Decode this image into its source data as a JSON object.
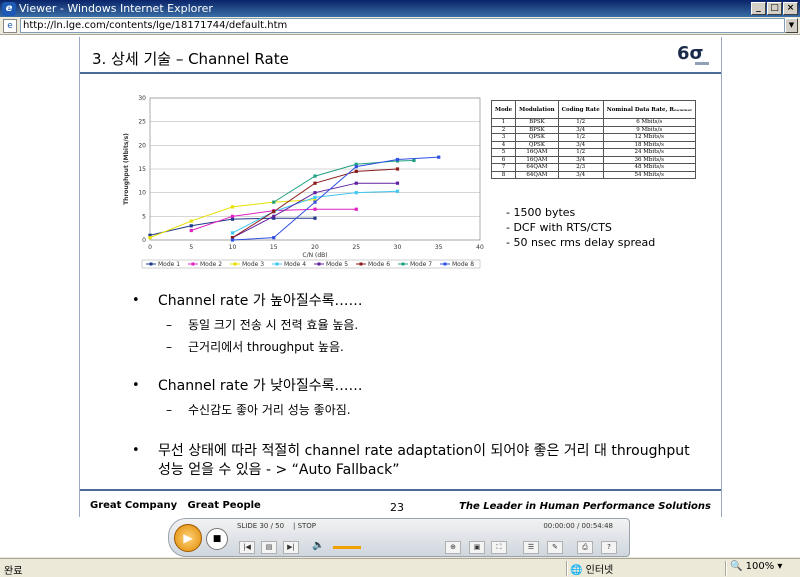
{
  "window": {
    "title": "Viewer - Windows Internet Explorer",
    "url": "http://ln.lge.com/contents/lge/18171744/default.htm"
  },
  "slide": {
    "title": "3. 상세 기술 – Channel Rate",
    "logo": "6σ",
    "notes": [
      "- 1500 bytes",
      "- DCF with RTS/CTS",
      "- 50 nsec rms delay spread"
    ],
    "bullets": [
      {
        "text": "Channel rate 가 높아질수록……",
        "subs": [
          "동일 크기 전송 시 전력 효율 높음.",
          "근거리에서 throughput 높음."
        ]
      },
      {
        "text": "Channel rate 가 낮아질수록……",
        "subs": [
          "수신감도 좋아 거리 성능 좋아짐."
        ]
      },
      {
        "text": "무선 상태에 따라 적절히 channel rate adaptation이 되어야 좋은 거리 대 throughput 성능 얻을 수 있음 - > “Auto Fallback”",
        "subs": []
      }
    ],
    "footer_left": "Great Company   Great People",
    "page_number": "23",
    "footer_right": "The Leader in Human Performance Solutions"
  },
  "mode_table": {
    "headers": [
      "Mode",
      "Modulation",
      "Coding Rate",
      "Nominal Data Rate, Rₙₒₘᵢₙₐₗ"
    ],
    "rows": [
      [
        "1",
        "BPSK",
        "1/2",
        "6 Mbits/s"
      ],
      [
        "2",
        "BPSK",
        "3/4",
        "9 Mbits/s"
      ],
      [
        "3",
        "QPSK",
        "1/2",
        "12 Mbits/s"
      ],
      [
        "4",
        "QPSK",
        "3/4",
        "18 Mbits/s"
      ],
      [
        "5",
        "16QAM",
        "1/2",
        "24 Mbits/s"
      ],
      [
        "6",
        "16QAM",
        "3/4",
        "36 Mbits/s"
      ],
      [
        "7",
        "64QAM",
        "2/3",
        "48 Mbits/s"
      ],
      [
        "8",
        "64QAM",
        "3/4",
        "54 Mbits/s"
      ]
    ]
  },
  "chart_data": {
    "type": "line",
    "title": "",
    "xlabel": "C/N (dB)",
    "ylabel": "Throughput (Mbits/s)",
    "xlim": [
      0,
      40
    ],
    "ylim": [
      0,
      30
    ],
    "x_ticks": [
      0,
      5,
      10,
      15,
      20,
      25,
      30,
      35,
      40
    ],
    "y_ticks": [
      0,
      5,
      10,
      15,
      20,
      25,
      30
    ],
    "grid": true,
    "legend_position": "bottom",
    "series": [
      {
        "name": "Mode 1",
        "color": "#1f3a8a",
        "x": [
          0,
          5,
          10,
          15,
          20
        ],
        "y": [
          1,
          3,
          4.4,
          4.6,
          4.6
        ]
      },
      {
        "name": "Mode 2",
        "color": "#e020c0",
        "x": [
          5,
          10,
          15,
          20,
          25
        ],
        "y": [
          2,
          5,
          6.2,
          6.5,
          6.5
        ]
      },
      {
        "name": "Mode 3",
        "color": "#e8e000",
        "x": [
          0,
          5,
          10,
          15,
          20
        ],
        "y": [
          0.5,
          4,
          7,
          8,
          8.5
        ]
      },
      {
        "name": "Mode 4",
        "color": "#40c8f0",
        "x": [
          10,
          15,
          20,
          25,
          30
        ],
        "y": [
          1.5,
          6,
          9,
          10,
          10.3
        ]
      },
      {
        "name": "Mode 5",
        "color": "#6020a0",
        "x": [
          10,
          15,
          20,
          25,
          30
        ],
        "y": [
          0.5,
          5,
          10,
          12,
          12
        ]
      },
      {
        "name": "Mode 6",
        "color": "#8b1a1a",
        "x": [
          10,
          15,
          20,
          25,
          30
        ],
        "y": [
          0.5,
          6,
          12,
          14.5,
          15
        ]
      },
      {
        "name": "Mode 7",
        "color": "#20a080",
        "x": [
          15,
          20,
          25,
          30,
          32
        ],
        "y": [
          8,
          13.5,
          16,
          16.7,
          16.8
        ]
      },
      {
        "name": "Mode 8",
        "color": "#3050e0",
        "x": [
          10,
          15,
          20,
          25,
          30,
          35
        ],
        "y": [
          0,
          0.5,
          8,
          15.5,
          17,
          17.5
        ]
      }
    ]
  },
  "player": {
    "slide_status": "SLIDE 30 / 50",
    "state": "| STOP",
    "time": "00:00:00 / 00:54:48",
    "play_icon": "▶",
    "stop_icon": "■"
  },
  "statusbar": {
    "left": "완료",
    "zone": "인터넷",
    "zoom": "100%"
  }
}
